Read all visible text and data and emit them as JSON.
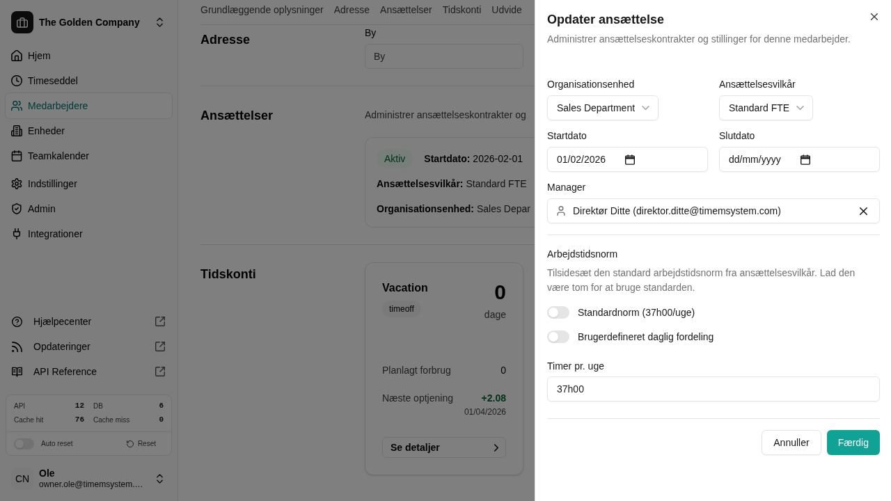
{
  "sidebar": {
    "company": "The Golden Company",
    "nav_groups": [
      {
        "items": [
          {
            "label": "Hjem",
            "selected": false
          },
          {
            "label": "Timeseddel",
            "selected": false
          },
          {
            "label": "Medarbejdere",
            "selected": true
          },
          {
            "label": "Enheder",
            "selected": false
          },
          {
            "label": "Teamkalender",
            "selected": false
          }
        ]
      },
      {
        "items": [
          {
            "label": "Indstillinger",
            "selected": false
          },
          {
            "label": "Admin",
            "selected": false
          },
          {
            "label": "Integrationer",
            "selected": false
          }
        ]
      }
    ],
    "links": [
      {
        "label": "Hjælpecenter"
      },
      {
        "label": "Opdateringer"
      },
      {
        "label": "API Reference"
      }
    ],
    "stats": {
      "metrics": [
        {
          "label": "API",
          "value": "12"
        },
        {
          "label": "DB",
          "value": "6"
        },
        {
          "label": "Cache hit",
          "value": "76"
        },
        {
          "label": "Cache miss",
          "value": "0"
        }
      ],
      "auto_reset": {
        "label": "Auto reset",
        "on": false
      },
      "reset_button": "Reset"
    },
    "user": {
      "initials": "CN",
      "name": "Ole",
      "email": "owner.ole@timemsystem.…"
    }
  },
  "main": {
    "tabs": [
      "Grundlæggende oplysninger",
      "Adresse",
      "Ansættelser",
      "Tidskonti",
      "Udvide"
    ],
    "address": {
      "title": "Adresse",
      "field": {
        "label": "By",
        "placeholder": "By"
      }
    },
    "employments": {
      "title": "Ansættelser",
      "description": "Administrer ansættelseskontrakter og",
      "contract": {
        "status": "Aktiv",
        "lines": [
          "**Startdato:** 2026-02-01",
          "**Ansættelsesvilkår:** Standard FTE",
          "**Organisationsenhed:** Sales Depar"
        ]
      }
    },
    "time_accounts": {
      "title": "Tidskonti",
      "account": {
        "name": "Vacation",
        "tag": "timeoff",
        "balance": "0",
        "unit": "dage",
        "rows": [
          {
            "kind": "plain",
            "label": "Planlagt forbrug",
            "value": "0"
          },
          {
            "kind": "accrual",
            "label": "Næste optjening",
            "value": "+2.08",
            "date": "01/04/2026"
          }
        ],
        "button": "Se detaljer"
      }
    }
  },
  "dialog": {
    "title": "Opdater ansættelse",
    "description": "Administrer ansættelseskontrakter og stillinger for denne medarbejder.",
    "org_unit": {
      "label": "Organisationsenhed",
      "value": "Sales Department"
    },
    "terms": {
      "label": "Ansættelsesvilkår",
      "value": "Standard FTE"
    },
    "start_date": {
      "label": "Startdato",
      "value": "01/02/2026"
    },
    "end_date": {
      "label": "Slutdato",
      "placeholder": "dd/mm/yyyy"
    },
    "manager": {
      "label": "Manager",
      "value": "Direktør Ditte (direktor.ditte@timemsystem.com)"
    },
    "work_norm": {
      "title": "Arbejdstidsnorm",
      "description": "Tilsidesæt den standard arbejdstidsnorm fra ansættelsesvilkår. Lad den være tom for at bruge standarden.",
      "toggles": [
        {
          "label": "Standardnorm (37h00/uge)",
          "on": false
        },
        {
          "label": "Brugerdefineret daglig fordeling",
          "on": false
        }
      ],
      "hours": {
        "label": "Timer pr. uge",
        "value": "37h00"
      }
    },
    "buttons": [
      {
        "label": "Annuller",
        "kind": "secondary"
      },
      {
        "label": "Færdig",
        "kind": "primary"
      }
    ]
  }
}
